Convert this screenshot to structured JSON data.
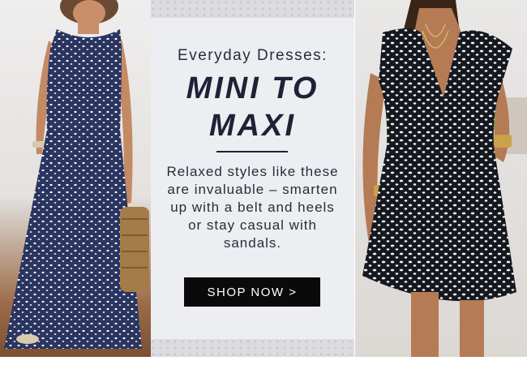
{
  "banner": {
    "kicker": "Everyday Dresses:",
    "headline_line1": "MINI TO",
    "headline_line2": "MAXI",
    "body": "Relaxed styles like these are invaluable – smarten up with a belt and heels or stay casual with sandals.",
    "cta_label": "SHOP NOW >"
  },
  "colors": {
    "panel_bg": "#edeef2",
    "headline": "#1f2136",
    "cta_bg": "#0a0a0a",
    "cta_text": "#ffffff",
    "dress_navy": "#2a3560",
    "dress_print": "#ffffff"
  },
  "images": {
    "left": "woman-in-navy-floral-maxi-dress",
    "right": "woman-in-black-white-print-mini-dress"
  }
}
